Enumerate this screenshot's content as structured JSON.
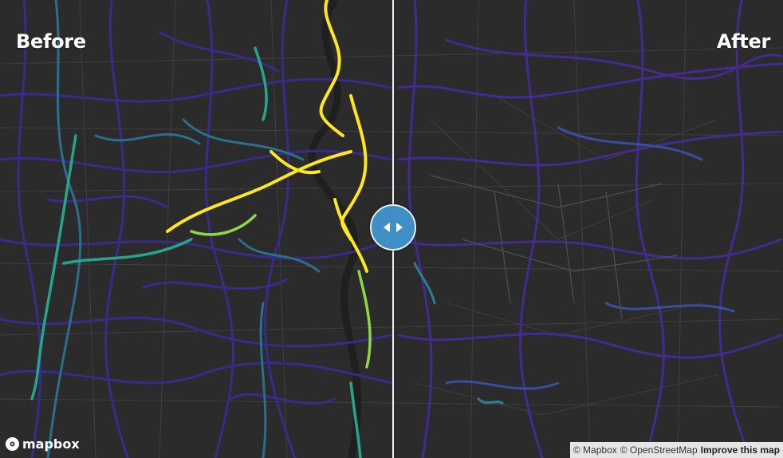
{
  "labels": {
    "before": "Before",
    "after": "After"
  },
  "branding": {
    "logo_text": "mapbox"
  },
  "attribution": {
    "mapbox": "© Mapbox",
    "osm": "© OpenStreetMap",
    "improve": "Improve this map"
  },
  "slider": {
    "position_fraction": 0.502
  },
  "colors": {
    "background": "#2b2b2b",
    "base_roads": "#444444",
    "low": "#432b8f",
    "mid_low": "#3b528b",
    "mid": "#21918c",
    "mid_high": "#5ec962",
    "high": "#fde725"
  },
  "icons": {
    "handle": "left-right-arrows-icon",
    "logo": "mapbox-logo-icon"
  }
}
